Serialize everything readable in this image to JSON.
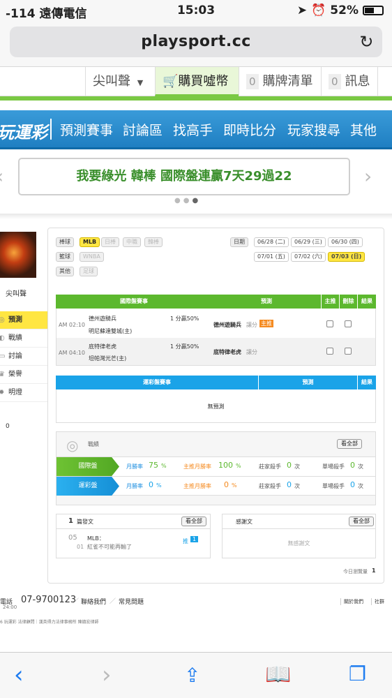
{
  "status_bar": {
    "carrier": "-114 遠傳電信",
    "time": "15:03",
    "battery": "52%"
  },
  "browser": {
    "url": "playsport.cc"
  },
  "top_nav": {
    "user": "尖叫聲",
    "buy": "購買噓幣",
    "cart_count": "0",
    "cart": "購牌清單",
    "msg_count": "0",
    "msg": "訊息"
  },
  "main_nav": {
    "logo": "玩運彩",
    "items": [
      "預測賽事",
      "討論區",
      "找高手",
      "即時比分",
      "玩家搜尋",
      "其他"
    ]
  },
  "banner": {
    "text": "我要綠光 韓棒 國際盤連贏7天29過22"
  },
  "profile": {
    "name": "尖叫聲",
    "menu": [
      "預測",
      "戰績",
      "討論",
      "榮譽",
      "明燈"
    ],
    "extra_count": "0"
  },
  "filters": {
    "baseball_label": "棒球",
    "baseball": [
      "MLB",
      "日棒",
      "中職",
      "韓棒"
    ],
    "basketball_label": "籃球",
    "basketball": [
      "WNBA"
    ],
    "other_label": "其他",
    "other": [
      "足球"
    ],
    "date_label": "日期",
    "dates": [
      "06/28 (二)",
      "06/29 (三)",
      "06/30 (四)",
      "07/01 (五)",
      "07/02 (六)",
      "07/03 (日)"
    ]
  },
  "intl_table": {
    "headers": [
      "國際盤賽事",
      "預測",
      "主推",
      "刪除",
      "結果"
    ],
    "rows": [
      {
        "time": "AM 02:10",
        "team1": "德州遊騎兵",
        "team2": "明尼蘇達雙城(主)",
        "line": "1 分贏50%",
        "pick": "德州遊騎兵",
        "type": "讓分",
        "badge": "主推"
      },
      {
        "time": "AM 04:10",
        "team1": "底特律老虎",
        "team2": "坦帕灣光芒(主)",
        "line": "1 分贏50%",
        "pick": "底特律老虎",
        "type": "讓分"
      }
    ]
  },
  "lottery_table": {
    "headers": [
      "運彩盤賽事",
      "預測",
      "結果"
    ],
    "empty": "無預測"
  },
  "record": {
    "title": "戰績",
    "view_all": "看全部",
    "intl": {
      "label": "國際盤",
      "monthly": "月勝率",
      "monthly_val": "75",
      "pct": "%",
      "main_monthly": "主推月勝率",
      "main_val": "100",
      "killer": "莊家殺手",
      "killer_val": "0",
      "unit": "次",
      "single": "單場殺手",
      "single_val": "0"
    },
    "lottery": {
      "label": "運彩盤",
      "monthly": "月勝率",
      "monthly_val": "0",
      "pct": "%",
      "main_monthly": "主推月勝率",
      "main_val": "0",
      "killer": "莊家殺手",
      "killer_val": "0",
      "unit": "次",
      "single": "單場殺手",
      "single_val": "0"
    }
  },
  "posts": {
    "count": "1",
    "title": "篇發文",
    "view_all": "看全部",
    "item": {
      "month": "05",
      "day": "01",
      "category": "MLB：",
      "text": "紅雀不可能再輸了",
      "push_label": "推",
      "push_count": "1"
    }
  },
  "thanks": {
    "title": "感謝文",
    "view_all": "看全部",
    "empty": "無感謝文"
  },
  "today_views": {
    "label": "今日瀏覽量",
    "value": "1"
  },
  "footer": {
    "phone_label": "電話",
    "phone": "07-9700123",
    "hours": "24:00",
    "links": [
      "聯絡我們",
      "常見問題"
    ],
    "right_links": [
      "關於我們",
      "社群"
    ],
    "legal": "6 玩運彩 法律顧問｜漢英得力法律事務所 陳鎮宏律師"
  }
}
